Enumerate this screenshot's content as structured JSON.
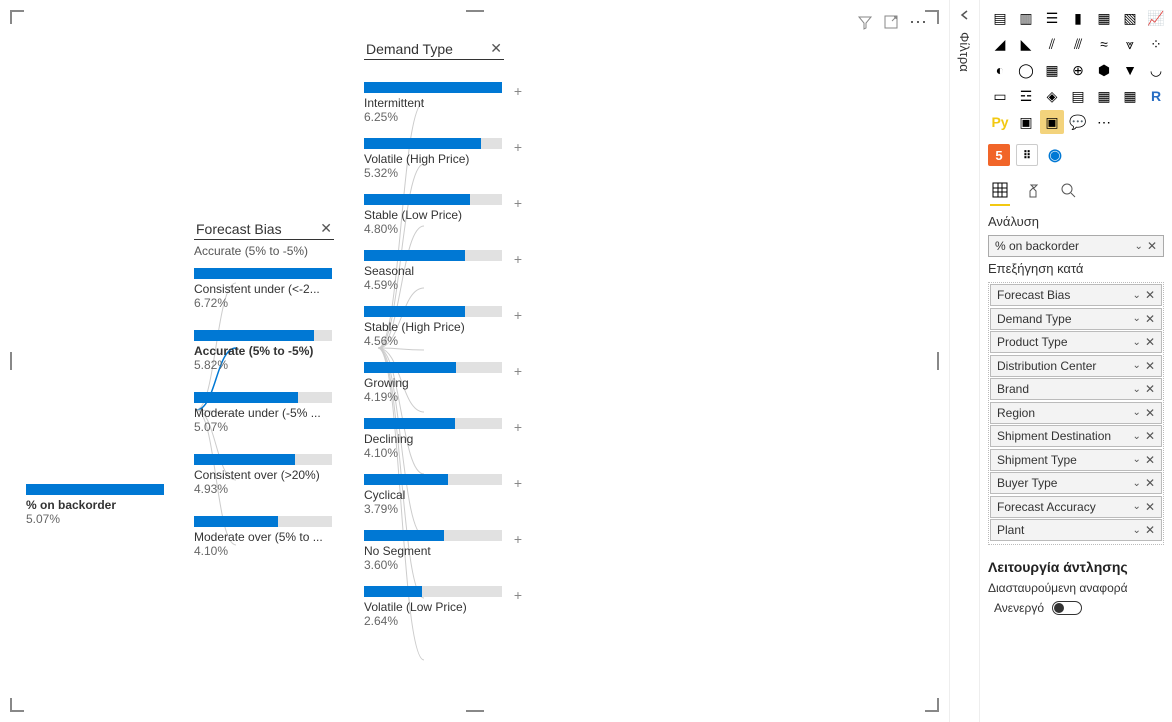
{
  "filters_label": "Φίλτρα",
  "tree": {
    "column1_header": "Forecast Bias",
    "column1_sub": "Accurate (5% to -5%)",
    "column2_header": "Demand Type",
    "root": {
      "label": "% on backorder",
      "value": "5.07%",
      "fill": 100
    },
    "level1": [
      {
        "label": "Consistent under (<-2...",
        "value": "6.72%",
        "fill": 100
      },
      {
        "label": "Accurate (5% to -5%)",
        "value": "5.82%",
        "fill": 87,
        "selected": true
      },
      {
        "label": "Moderate under (-5% ...",
        "value": "5.07%",
        "fill": 75
      },
      {
        "label": "Consistent over (>20%)",
        "value": "4.93%",
        "fill": 73
      },
      {
        "label": "Moderate over (5% to ...",
        "value": "4.10%",
        "fill": 61
      }
    ],
    "level2": [
      {
        "label": "Intermittent",
        "value": "6.25%",
        "fill": 100
      },
      {
        "label": "Volatile (High Price)",
        "value": "5.32%",
        "fill": 85
      },
      {
        "label": "Stable (Low Price)",
        "value": "4.80%",
        "fill": 77
      },
      {
        "label": "Seasonal",
        "value": "4.59%",
        "fill": 73
      },
      {
        "label": "Stable (High Price)",
        "value": "4.56%",
        "fill": 73
      },
      {
        "label": "Growing",
        "value": "4.19%",
        "fill": 67
      },
      {
        "label": "Declining",
        "value": "4.10%",
        "fill": 66
      },
      {
        "label": "Cyclical",
        "value": "3.79%",
        "fill": 61
      },
      {
        "label": "No Segment",
        "value": "3.60%",
        "fill": 58
      },
      {
        "label": "Volatile (Low Price)",
        "value": "2.64%",
        "fill": 42
      }
    ]
  },
  "analysis": {
    "tab_label": "Ανάλυση",
    "analyze_field": "% on backorder",
    "explain_by_label": "Επεξήγηση κατά",
    "explain_by": [
      "Forecast Bias",
      "Demand Type",
      "Product Type",
      "Distribution Center",
      "Brand",
      "Region",
      "Shipment Destination",
      "Shipment Type",
      "Buyer Type",
      "Forecast Accuracy",
      "Plant"
    ]
  },
  "drill": {
    "title": "Λειτουργία άντλησης",
    "subtitle": "Διασταυρούμενη αναφορά",
    "toggle": "Ανενεργό"
  },
  "viz_icons": [
    "stacked-bar-h",
    "stacked-bar-v",
    "clustered-bar-h",
    "clustered-bar-v",
    "hundred-bar-h",
    "hundred-bar-v",
    "line",
    "area",
    "stacked-area",
    "line-bar",
    "line-bar-2",
    "ribbon",
    "waterfall",
    "scatter",
    "pie",
    "donut",
    "treemap",
    "map",
    "filled-map",
    "funnel",
    "gauge",
    "card",
    "multi-row-card",
    "kpi",
    "slicer",
    "table",
    "matrix",
    "r-visual",
    "py-visual",
    "key-influencers",
    "decomposition-tree",
    "qna",
    "more"
  ]
}
